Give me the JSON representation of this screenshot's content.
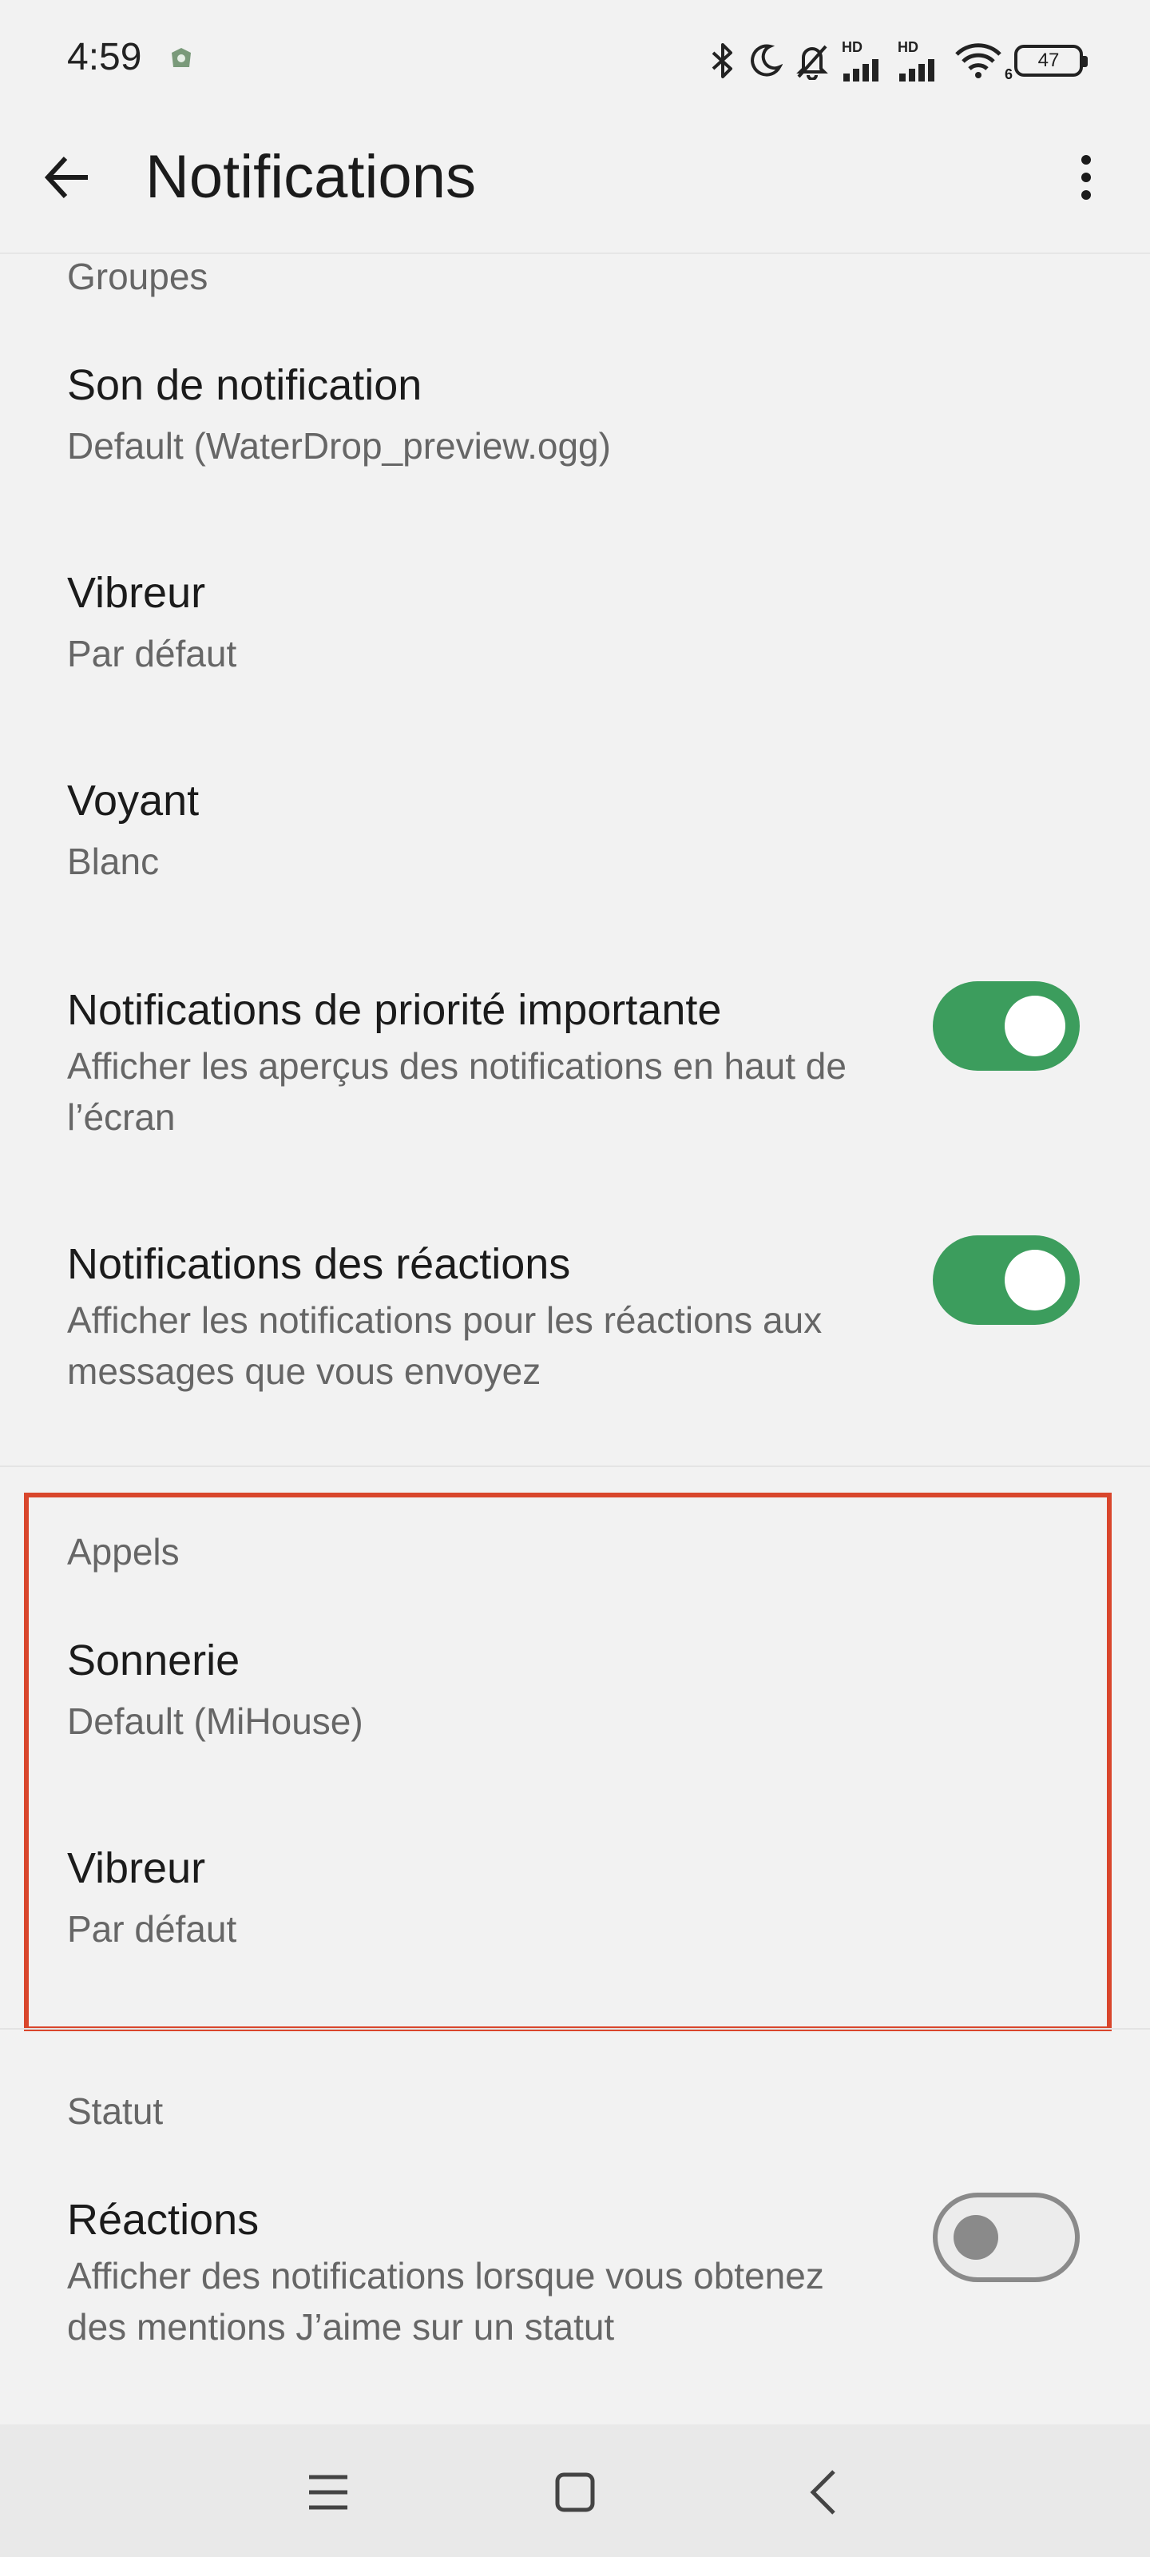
{
  "status_bar": {
    "time": "4:59",
    "icons": [
      "bluetooth-icon",
      "moon-icon",
      "bell-off-icon",
      "signal-hd-icon",
      "signal-hd-icon",
      "wifi-icon",
      "battery-icon"
    ],
    "hd_label": "HD",
    "wifi_label": "6",
    "battery_level": "47"
  },
  "toolbar": {
    "title": "Notifications",
    "back_icon": "arrow-left-icon",
    "more_icon": "more-vertical-icon"
  },
  "sections": {
    "groupes": {
      "header": "Groupes",
      "items": [
        {
          "title": "Son de notification",
          "summary": "Default (WaterDrop_preview.ogg)"
        },
        {
          "title": "Vibreur",
          "summary": "Par défaut"
        },
        {
          "title": "Voyant",
          "summary": "Blanc"
        },
        {
          "title": "Notifications de priorité importante",
          "summary": "Afficher les aperçus des notifications en haut de l’écran",
          "switch": "on"
        },
        {
          "title": "Notifications des réactions",
          "summary": "Afficher les notifications pour les réactions aux messages que vous envoyez",
          "switch": "on"
        }
      ]
    },
    "appels": {
      "header": "Appels",
      "items": [
        {
          "title": "Sonnerie",
          "summary": "Default (MiHouse)"
        },
        {
          "title": "Vibreur",
          "summary": "Par défaut"
        }
      ]
    },
    "statut": {
      "header": "Statut",
      "items": [
        {
          "title": "Réactions",
          "summary": "Afficher des notifications lorsque vous obtenez des mentions J’aime sur un statut",
          "switch": "off"
        }
      ]
    }
  },
  "colors": {
    "switch_on": "#3c9d5d",
    "switch_off": "#8a8a8a",
    "highlight": "#d9462c"
  },
  "nav_bar": {
    "icons": [
      "menu-icon",
      "home-square-icon",
      "back-chevron-icon"
    ]
  }
}
